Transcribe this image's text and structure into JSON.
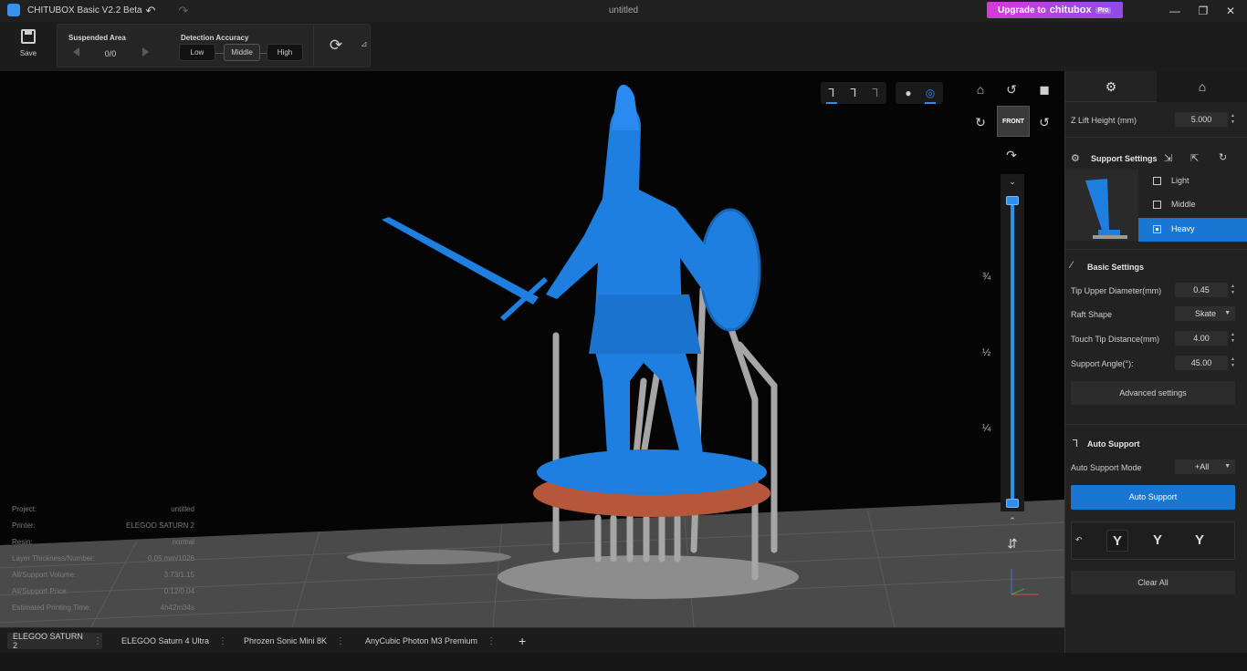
{
  "app": {
    "title": "CHITUBOX Basic V2.2 Beta",
    "document_title": "untitled",
    "upgrade": {
      "prefix": "Upgrade to",
      "brand": "chitubox",
      "badge": "Pro"
    }
  },
  "toolbar": {
    "save_label": "Save",
    "suspended_area": {
      "label": "Suspended Area",
      "count": "0/0"
    },
    "detection_accuracy": {
      "label": "Detection Accuracy",
      "options": [
        "Low",
        "Middle",
        "High"
      ],
      "selected": "Middle"
    }
  },
  "viewport": {
    "cube_label": "FRONT",
    "slider_ticks": [
      "¾",
      "½",
      "¼"
    ],
    "slider_level": {
      "top": 1.0,
      "bottom": 0.0
    },
    "info": [
      {
        "key": "Project:",
        "value": "untitled"
      },
      {
        "key": "Printer:",
        "value": "ELEGOO SATURN 2"
      },
      {
        "key": "Resin:",
        "value": "normal"
      },
      {
        "key": "Layer Thickness/Number:",
        "value": "0.05 mm/1026"
      },
      {
        "key": "All/Support Volume:",
        "value": "3.73/1.15"
      },
      {
        "key": "All/Support Price:",
        "value": "0.12/0.04"
      },
      {
        "key": "Estimated Printing Time:",
        "value": "4h42m34s"
      }
    ]
  },
  "tabs": [
    {
      "label": "ELEGOO SATURN 2",
      "active": true
    },
    {
      "label": "ELEGOO Saturn 4 Ultra",
      "active": false
    },
    {
      "label": "Phrozen Sonic Mini 8K",
      "active": false
    },
    {
      "label": "AnyCubic Photon M3 Premium",
      "active": false
    }
  ],
  "right_panel": {
    "z_lift": {
      "label": "Z Lift Height (mm)",
      "value": "5.000"
    },
    "support_settings": {
      "label": "Support Settings",
      "options": [
        "Light",
        "Middle",
        "Heavy"
      ],
      "selected": "Heavy"
    },
    "basic_settings": {
      "label": "Basic Settings",
      "tip_upper_diameter": {
        "label": "Tip Upper Diameter(mm)",
        "value": "0.45"
      },
      "raft_shape": {
        "label": "Raft Shape",
        "value": "Skate"
      },
      "touch_tip_distance": {
        "label": "Touch Tip Distance(mm)",
        "value": "4.00"
      },
      "support_angle": {
        "label": "Support Angle(°):",
        "value": "45.00"
      },
      "advanced_label": "Advanced settings"
    },
    "auto_support": {
      "label": "Auto Support",
      "mode_label": "Auto Support Mode",
      "mode_value": "+All",
      "button_label": "Auto Support"
    },
    "clear_all_label": "Clear All"
  },
  "colors": {
    "accent": "#1976d2",
    "model": "#1e7fe0",
    "support": "#9a9a9a",
    "raft": "#b5573a",
    "upgrade_gradient": [
      "#d43bd6",
      "#8f4be8"
    ]
  }
}
